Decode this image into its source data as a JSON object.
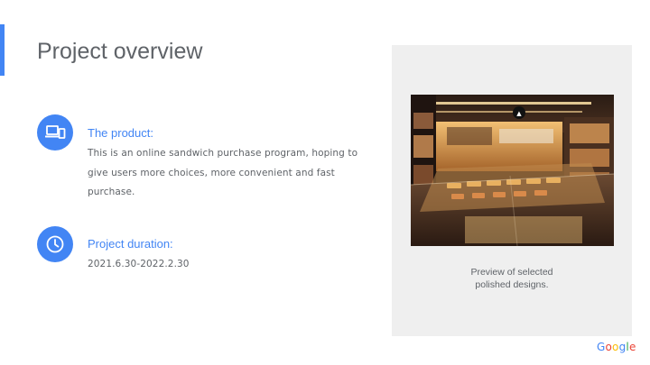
{
  "slide": {
    "title": "Project overview",
    "accent_color": "#4285f4"
  },
  "sections": [
    {
      "icon": "laptop-phone-icon",
      "label": "The product:",
      "text": "This is an online sandwich purchase program, hoping to give users more choices, more convenient and fast purchase."
    },
    {
      "icon": "clock-icon",
      "label": "Project duration:",
      "text": "2021.6.30-2022.2.30"
    }
  ],
  "preview": {
    "image": "sandwich-shop-interior-photo",
    "caption_line1": "Preview of selected",
    "caption_line2": "polished designs."
  },
  "logo": {
    "letters": [
      "G",
      "o",
      "o",
      "g",
      "l",
      "e"
    ],
    "colors": [
      "#4285f4",
      "#ea4335",
      "#fbbc05",
      "#4285f4",
      "#34a853",
      "#ea4335"
    ]
  }
}
